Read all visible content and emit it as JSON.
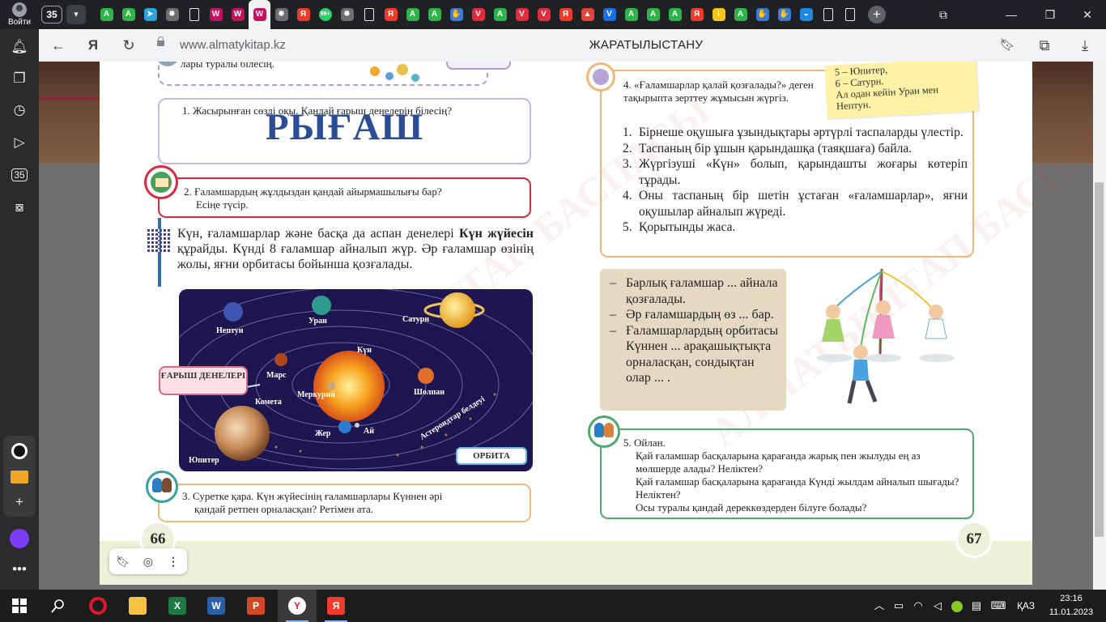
{
  "browser": {
    "profile_label": "Войти",
    "tab_count": "35",
    "tab_favicons": [
      {
        "icon": "green-triangle-icon",
        "color": "#2fb44a",
        "glyph": "A"
      },
      {
        "icon": "green-triangle-icon",
        "color": "#2fb44a",
        "glyph": "A"
      },
      {
        "icon": "telegram-icon",
        "color": "#2aa3e0",
        "glyph": "➤"
      },
      {
        "icon": "gear-icon",
        "color": "#6d6d6d",
        "glyph": "✸"
      },
      {
        "icon": "document-icon",
        "color": "#e8eaed",
        "glyph": ""
      },
      {
        "icon": "book-cover-icon",
        "color": "#c4125e",
        "glyph": "W"
      },
      {
        "icon": "book-cover-icon",
        "color": "#c4125e",
        "glyph": "W"
      },
      {
        "icon": "book-cover-icon",
        "color": "#c4125e",
        "glyph": "W"
      },
      {
        "icon": "gear-icon",
        "color": "#6d6d6d",
        "glyph": "✸"
      },
      {
        "icon": "yandex-icon",
        "color": "#f33a2a",
        "glyph": "Я"
      },
      {
        "icon": "whatsapp-icon",
        "color": "#25d366",
        "glyph": "99+"
      },
      {
        "icon": "gear-icon",
        "color": "#6d6d6d",
        "glyph": "✸"
      },
      {
        "icon": "document-icon",
        "color": "#e8eaed",
        "glyph": ""
      },
      {
        "icon": "yandex-icon",
        "color": "#f33a2a",
        "glyph": "Я"
      },
      {
        "icon": "green-triangle-icon",
        "color": "#2fb44a",
        "glyph": "A"
      },
      {
        "icon": "green-triangle-icon",
        "color": "#2fb44a",
        "glyph": "A"
      },
      {
        "icon": "hand-icon",
        "color": "#3b7bd8",
        "glyph": "✋"
      },
      {
        "icon": "shield-icon",
        "color": "#e02c3c",
        "glyph": "V"
      },
      {
        "icon": "green-triangle-icon",
        "color": "#2fb44a",
        "glyph": "A"
      },
      {
        "icon": "shield-icon",
        "color": "#e02c3c",
        "glyph": "V"
      },
      {
        "icon": "shield-icon",
        "color": "#e02c3c",
        "glyph": "V"
      },
      {
        "icon": "yandex-icon",
        "color": "#f33a2a",
        "glyph": "Я"
      },
      {
        "icon": "red-app-icon",
        "color": "#e2453a",
        "glyph": "▲"
      },
      {
        "icon": "v-icon",
        "color": "#1b6ee6",
        "glyph": "V"
      },
      {
        "icon": "green-triangle-icon",
        "color": "#2fb44a",
        "glyph": "A"
      },
      {
        "icon": "green-triangle-icon",
        "color": "#2fb44a",
        "glyph": "A"
      },
      {
        "icon": "green-triangle-icon",
        "color": "#2fb44a",
        "glyph": "A"
      },
      {
        "icon": "yandex-icon",
        "color": "#f33a2a",
        "glyph": "Я"
      },
      {
        "icon": "info-icon",
        "color": "#f5c518",
        "glyph": "i"
      },
      {
        "icon": "green-triangle-icon",
        "color": "#2fb44a",
        "glyph": "A"
      },
      {
        "icon": "hand-icon",
        "color": "#3b7bd8",
        "glyph": "✋"
      },
      {
        "icon": "hand-icon",
        "color": "#3b7bd8",
        "glyph": "✋"
      },
      {
        "icon": "globe-icon",
        "color": "#1e88e5",
        "glyph": "◒"
      },
      {
        "icon": "document-icon",
        "color": "#e8eaed",
        "glyph": ""
      },
      {
        "icon": "document-icon",
        "color": "#e8eaed",
        "glyph": ""
      }
    ],
    "active_tab_index": 7,
    "url": "www.almatykitap.kz",
    "page_title": "ЖАРАТЫЛЫСТАНУ"
  },
  "sidebar": {
    "items": [
      "bell-icon",
      "collections-icon",
      "history-icon",
      "play-icon",
      "tabs-35-icon",
      "screenshot-icon"
    ],
    "tabs_badge": "35",
    "bottom_items": [
      "alice-icon",
      "mail-icon",
      "add-icon",
      "alice-assistant-icon",
      "more-icon"
    ]
  },
  "page_left": {
    "page_number": "66",
    "top_fragment": "лары туралы білесің.",
    "task1": {
      "text": "1. Жасырынған сөзді оқы. Қандай ғарыш денелерін білесің?",
      "word": "РЫҒАШ"
    },
    "task2": {
      "line1": "2. Ғаламшардың жұлдыздан қандай айырмашылығы бар?",
      "line2": "Есіңе түсір."
    },
    "paragraph": {
      "p1": "Күн, ғаламшарлар және басқа да аспан денелері ",
      "bold": "Күн жүйесін",
      "p2": " құрайды. Күнді 8 ғаламшар айналып жүр. Әр ғаламшар өзінің жолы, яғни орбитасы бойынша қозғалады."
    },
    "solar_labels": {
      "neptune": "Нептун",
      "uranus": "Уран",
      "saturn": "Сатурн",
      "sun": "Күн",
      "mars": "Марс",
      "venus": "Шолпан",
      "comet": "Комета",
      "mercury": "Меркурий",
      "earth": "Жер",
      "moon": "Ай",
      "asteroid_belt": "Астероидтар белдеуі",
      "jupiter": "Юпитер"
    },
    "label_bodies": "ҒАРЫШ ДЕНЕЛЕРІ",
    "label_orbit": "ОРБИТА",
    "task3": {
      "line1": "3. Суретке қара. Күн жүйесінің ғаламшарлары Күннен әрі",
      "line2": "қандай ретпен орналасқан? Ретімен ата."
    }
  },
  "page_right": {
    "page_number": "67",
    "sticky": {
      "line1": "5 – Юпитер,",
      "line2": "6 – Сатурн.",
      "line3": "Ал одан кейін Уран мен",
      "line4": "Нептун."
    },
    "task4": {
      "intro": "4. «Ғаламшарлар қалай қозғалады?» деген тақырыпта зерттеу жұмысын жүргіз.",
      "steps": [
        {
          "n": "1.",
          "text": "Бірнеше оқушыға ұзындықтары әртүрлі таспаларды үлестір."
        },
        {
          "n": "2.",
          "text": "Таспаның бір ұшын қарындашқа (таяқшаға) байла."
        },
        {
          "n": "3.",
          "text": "Жүргізуші «Күн» болып, қарындашты жоғары көтеріп тұрады."
        },
        {
          "n": "4.",
          "text": "Оны таспаның бір шетін ұстаған «ғаламшарлар», яғни оқушылар айналып жүреді."
        },
        {
          "n": "5.",
          "text": "Қорытынды жаса."
        }
      ]
    },
    "fill_in": [
      "Барлық ғаламшар ... айнала қозғалады.",
      "Әр ғаламшардың өз ... бар.",
      "Ғаламшарлардың орбитасы Күннен ... арақашықтықта орналасқан, сондықтан олар ... ."
    ],
    "task5": {
      "title": "5. Ойлан.",
      "q1": "Қай ғаламшар басқаларына қарағанда жарық пен жылуды ең аз мөлшерде алады? Неліктен?",
      "q2": "Қай ғаламшар басқаларына қарағанда Күнді жылдам айналып шығады? Неліктен?",
      "q3": "Осы туралы қандай дереккөздерден білуге болады?"
    }
  },
  "watermark": "АЛМАТЫКІТАП БАСПАСЫ",
  "taskbar": {
    "apps": [
      "windows-start-icon",
      "search-icon",
      "opera-icon",
      "file-explorer-icon",
      "excel-icon",
      "word-icon",
      "powerpoint-icon",
      "yandex-browser-icon",
      "yandex-icon"
    ],
    "language": "ҚАЗ",
    "time": "23:16",
    "date": "11.01.2023"
  }
}
